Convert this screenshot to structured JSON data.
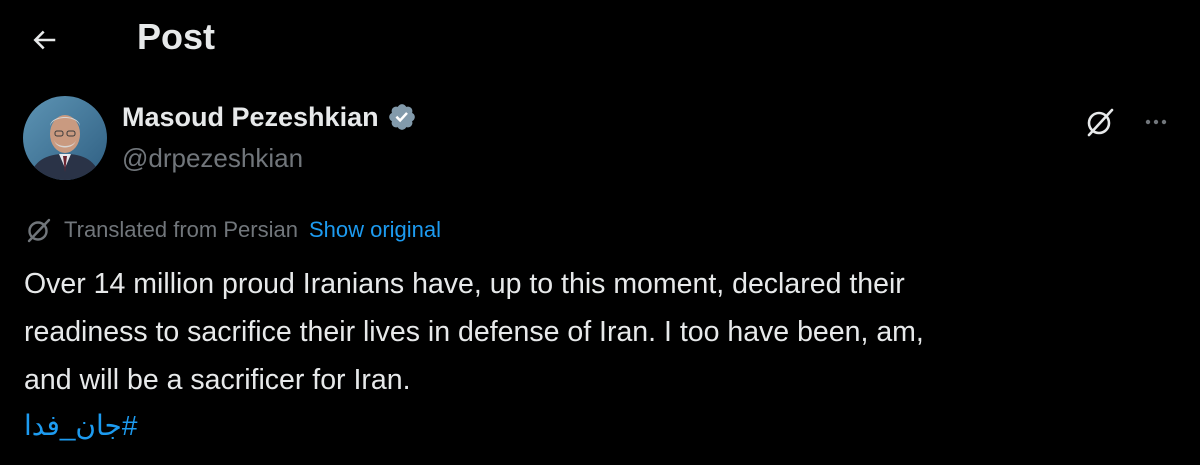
{
  "header": {
    "back_icon": "arrow-left-icon",
    "title": "Post"
  },
  "author": {
    "avatar_icon": "avatar",
    "name": "Masoud Pezeshkian",
    "verified_icon": "verified-badge-icon",
    "verified_color": "#829aab",
    "handle": "@drpezeshkian",
    "grok_icon": "grok-icon",
    "more_icon": "more-icon"
  },
  "translation": {
    "icon": "translate-icon",
    "label": "Translated from Persian",
    "show_original": "Show original"
  },
  "post": {
    "lines": [
      "Over 14 million proud Iranians have, up to this moment, declared their",
      "readiness to sacrifice their lives in defense of Iran. I too have been, am,",
      "and will be a sacrificer for Iran."
    ],
    "hashtag": "#جان_فدا"
  },
  "colors": {
    "background": "#000000",
    "text_primary": "#e7e9ea",
    "text_secondary": "#71767b",
    "link": "#1d9bf0"
  }
}
